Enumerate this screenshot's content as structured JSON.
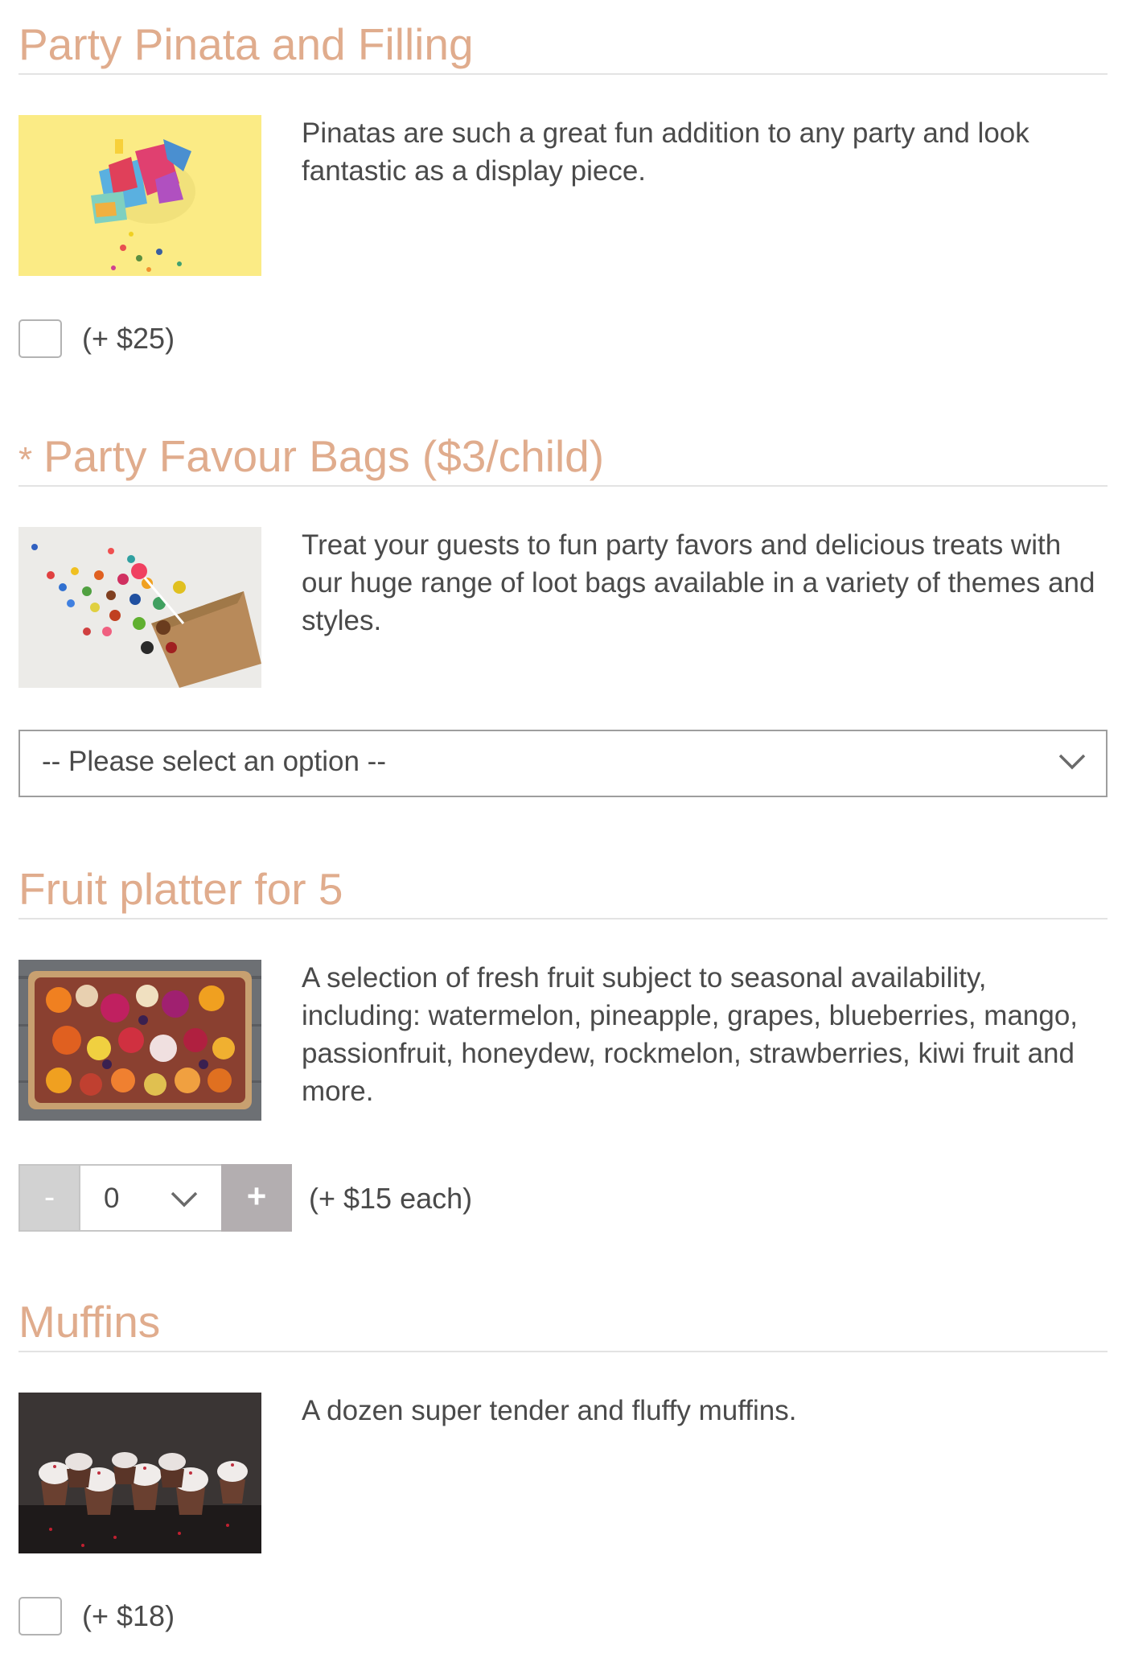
{
  "colors": {
    "heading": "#e0ac8d",
    "text": "#4a4a4a",
    "rule": "#e3e3e3",
    "border": "#9e9e9e",
    "stepper_minus": "#d2d2d2",
    "stepper_plus": "#b3aeb0"
  },
  "sections": [
    {
      "title": "Party Pinata and Filling",
      "required": false,
      "image": "pinata-photo",
      "description": "Pinatas are such a great fun addition to any party and look fantastic as a display piece.",
      "control": "checkbox",
      "checked": false,
      "price": "(+ $25)"
    },
    {
      "title": "Party Favour Bags ($3/child)",
      "required": true,
      "required_mark": "*",
      "image": "candy-bag-photo",
      "description": "Treat your guests to fun party favors and delicious treats with our huge range of loot bags available in a variety of themes and styles.",
      "control": "select",
      "select_value": "-- Please select an option --",
      "select_icon": "chevron-down-icon"
    },
    {
      "title": "Fruit platter for 5",
      "required": false,
      "image": "fruit-platter-photo",
      "description": "A selection of fresh fruit subject to seasonal availability, including: watermelon, pineapple, grapes, blueberries, mango, passionfruit, honeydew, rockmelon, strawberries, kiwi fruit and more.",
      "control": "stepper",
      "minus_label": "-",
      "quantity": "0",
      "plus_label": "+",
      "price": "(+ $15 each)"
    },
    {
      "title": "Muffins",
      "required": false,
      "image": "muffins-photo",
      "description": "A dozen super tender and fluffy muffins.",
      "control": "checkbox",
      "checked": false,
      "price": "(+ $18)"
    }
  ]
}
